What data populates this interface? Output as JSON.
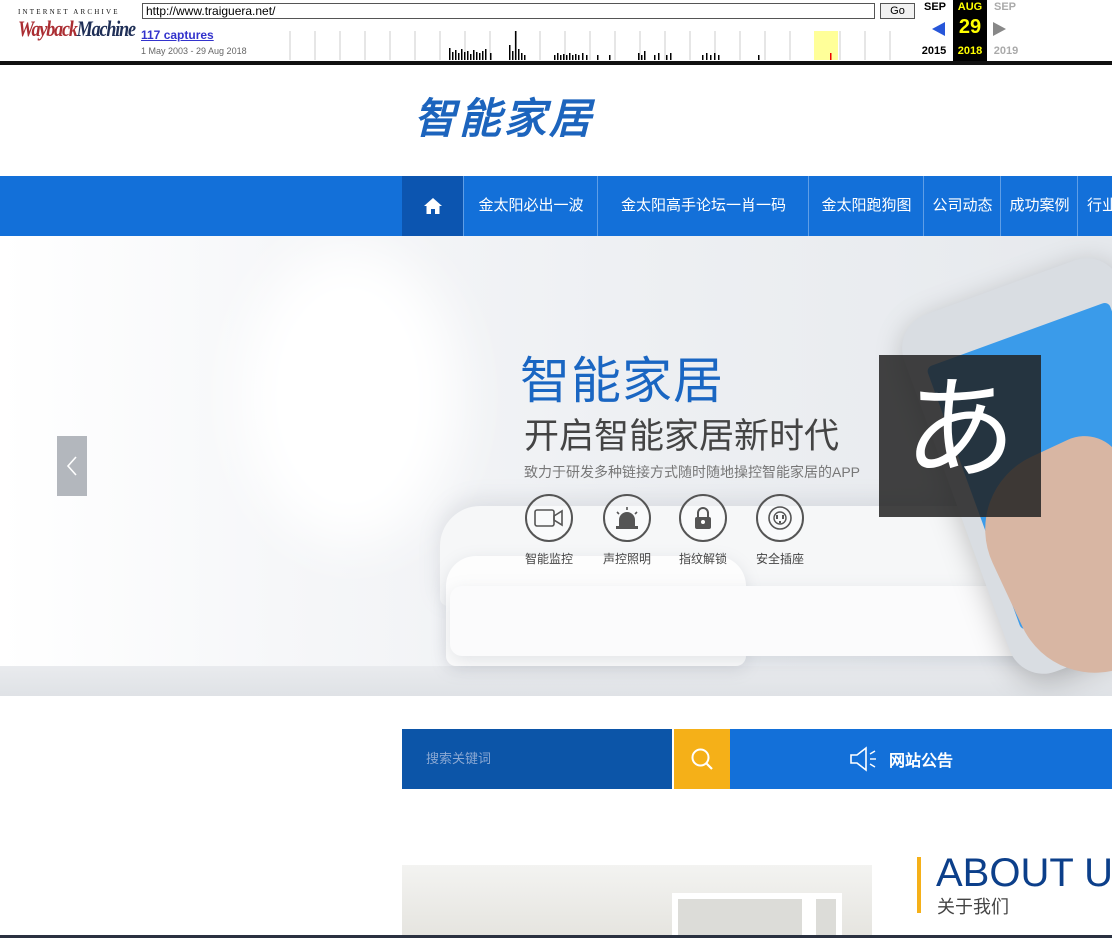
{
  "wayback": {
    "logo_top": "INTERNET ARCHIVE",
    "logo_main_a": "Wayback",
    "logo_main_b": "Machine",
    "url": "http://www.traiguera.net/",
    "go_label": "Go",
    "captures": "117 captures",
    "range": "1 May 2003 - 29 Aug 2018",
    "prev_month": "SEP",
    "cur_month": "AUG",
    "cur_day": "29",
    "next_month": "SEP",
    "prev_year": "2015",
    "cur_year": "2018",
    "next_year": "2019",
    "accent_color": "#ffff00"
  },
  "site": {
    "logo_text": "智能家居",
    "brand_color": "#1370d9"
  },
  "nav": {
    "home_icon": "home-icon",
    "items": [
      "金太阳必出一波",
      "金太阳高手论坛一肖一码",
      "金太阳跑狗图",
      "公司动态",
      "成功案例",
      "行业"
    ]
  },
  "banner": {
    "title": "智能家居",
    "subtitle": "开启智能家居新时代",
    "desc": "致力于研发多种链接方式随时随地操控智能家居的APP",
    "features": [
      {
        "icon": "video-camera-icon",
        "label": "智能监控"
      },
      {
        "icon": "alarm-light-icon",
        "label": "声控照明"
      },
      {
        "icon": "lock-icon",
        "label": "指纹解锁"
      },
      {
        "icon": "socket-icon",
        "label": "安全插座"
      }
    ],
    "ime_char": "あ"
  },
  "search": {
    "placeholder": "搜索关键词",
    "button_icon": "search-icon"
  },
  "notice": {
    "icon": "megaphone-icon",
    "label": "网站公告"
  },
  "about": {
    "title": "ABOUT U",
    "subtitle": "关于我们"
  }
}
